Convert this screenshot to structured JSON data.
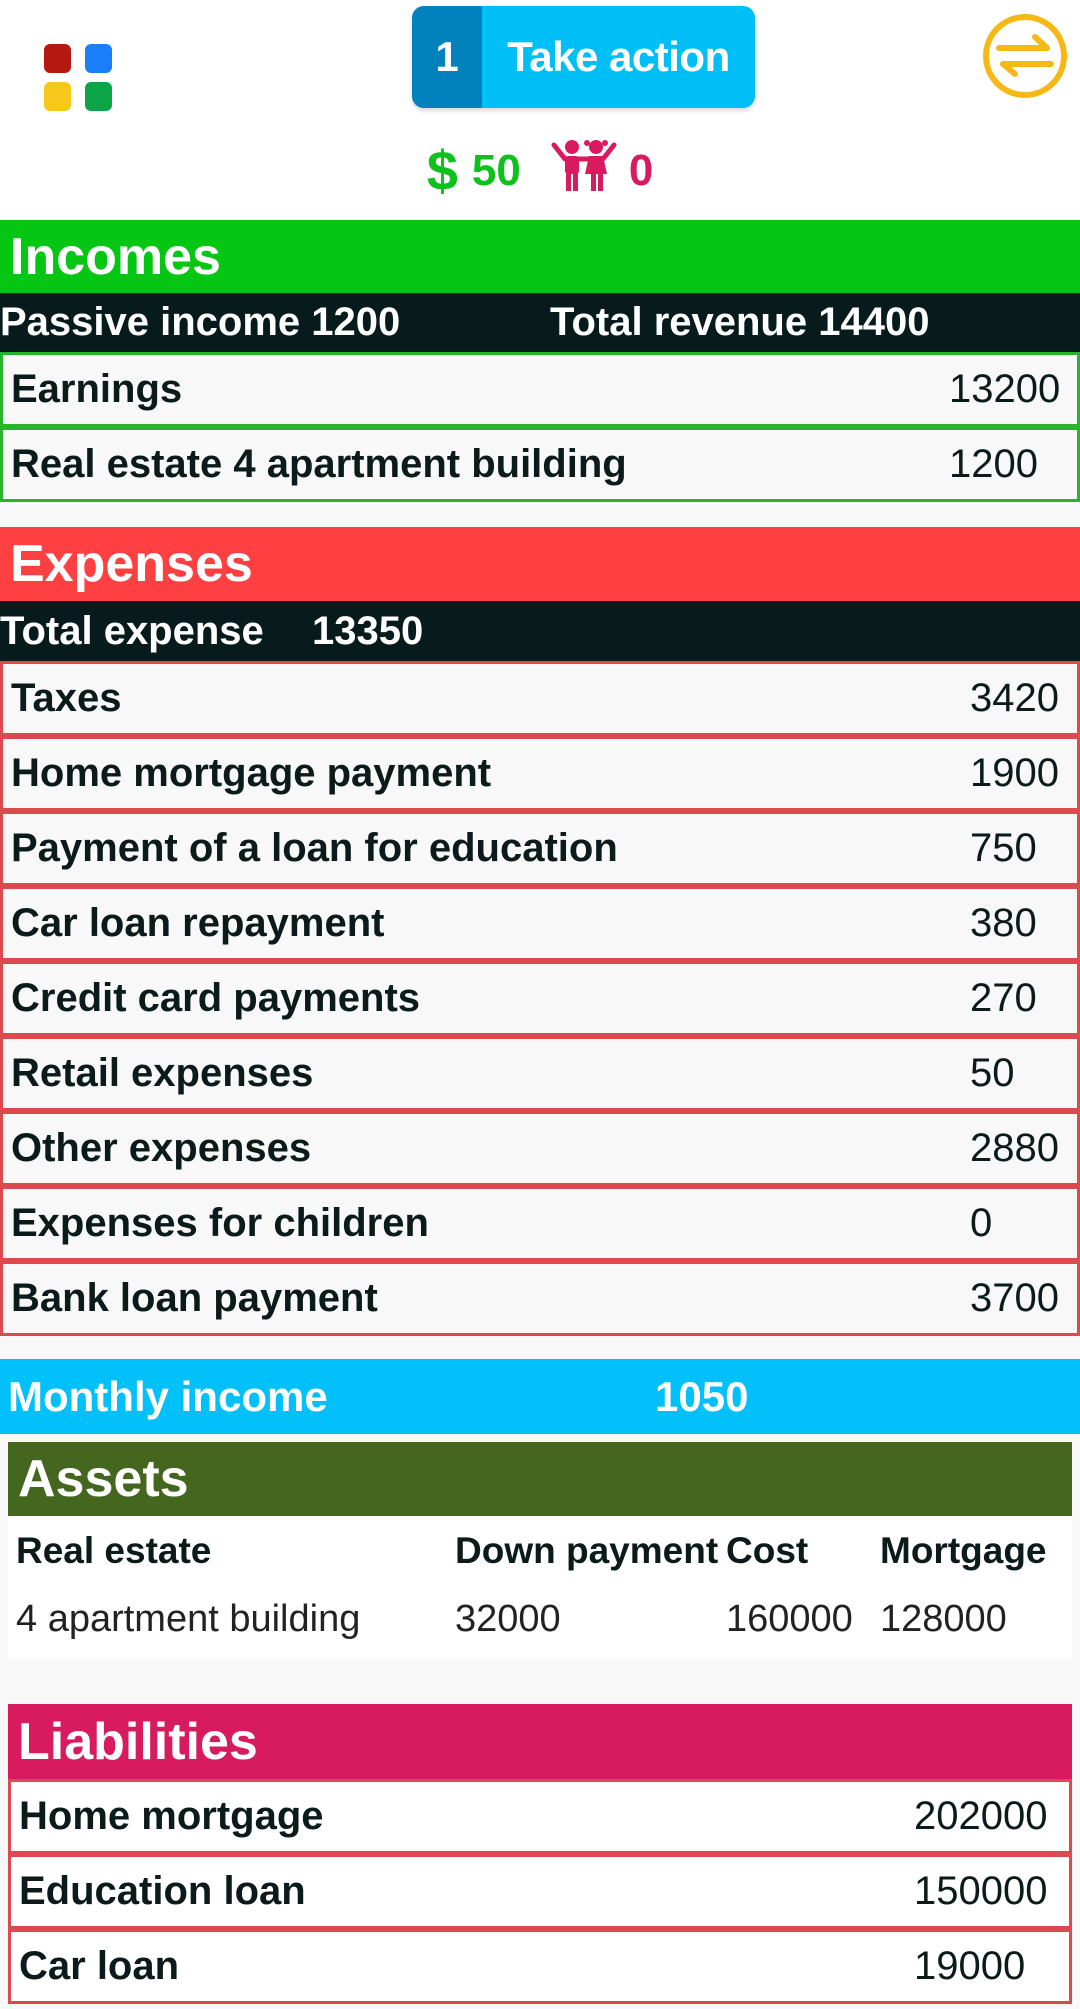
{
  "header": {
    "apps_icon": "apps-grid-icon",
    "action_count": "1",
    "action_label": "Take action",
    "swap_icon": "swap-arrows-icon",
    "money_symbol": "$",
    "money": "50",
    "children_icon": "children-icon",
    "children": "0"
  },
  "colors": {
    "incomes": "#06c614",
    "expenses": "#ff4043",
    "monthly": "#02c0f9",
    "assets": "#44661e",
    "liabilities": "#d81a5e",
    "dark": "#081b1c",
    "action": "#00bff7",
    "action_count": "#0282bc",
    "swap_icon": "#f5b815"
  },
  "incomes": {
    "title": "Incomes",
    "passive_income": "Passive income 1200",
    "total_revenue": "Total revenue 14400",
    "items": [
      {
        "label": "Earnings",
        "value": "13200"
      },
      {
        "label": "Real estate 4 apartment building",
        "value": "1200"
      }
    ]
  },
  "expenses": {
    "title": "Expenses",
    "total_label": "Total expense",
    "total_value": "13350",
    "items": [
      {
        "label": "Taxes",
        "value": "3420"
      },
      {
        "label": "Home mortgage payment",
        "value": "1900"
      },
      {
        "label": "Payment of a loan for education",
        "value": "750"
      },
      {
        "label": "Car loan repayment",
        "value": "380"
      },
      {
        "label": "Credit card payments",
        "value": "270"
      },
      {
        "label": "Retail expenses",
        "value": "50"
      },
      {
        "label": "Other expenses",
        "value": "2880"
      },
      {
        "label": "Expenses for children",
        "value": "0"
      },
      {
        "label": "Bank loan payment",
        "value": "3700"
      }
    ]
  },
  "monthly": {
    "label": "Monthly income",
    "value": "1050"
  },
  "assets": {
    "title": "Assets",
    "columns": [
      "Real estate",
      "Down payment",
      "Cost",
      "Mortgage"
    ],
    "rows": [
      [
        "4 apartment building",
        "32000",
        "160000",
        "128000"
      ]
    ]
  },
  "liabilities": {
    "title": "Liabilities",
    "items": [
      {
        "label": "Home mortgage",
        "value": "202000"
      },
      {
        "label": "Education loan",
        "value": "150000"
      },
      {
        "label": "Car loan",
        "value": "19000"
      }
    ]
  }
}
